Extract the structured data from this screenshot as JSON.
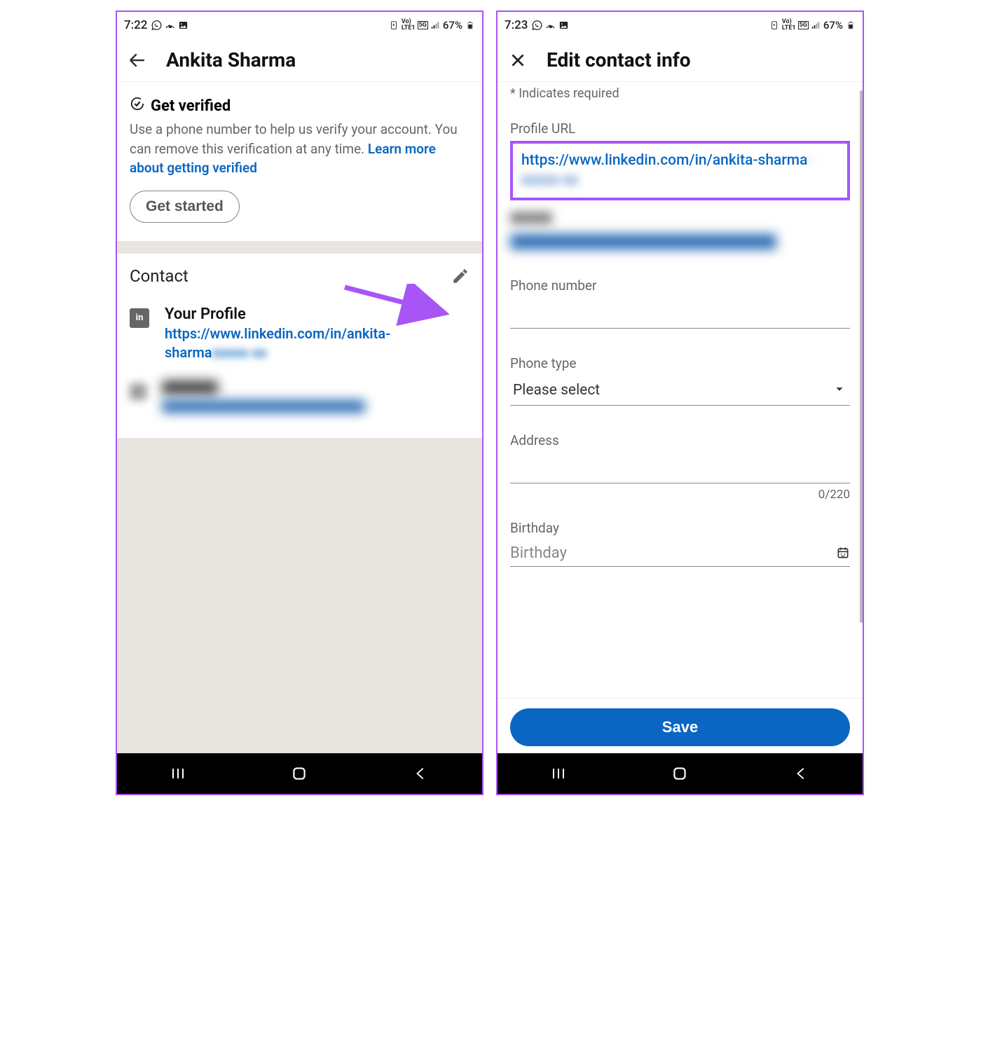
{
  "left": {
    "status": {
      "time": "7:22",
      "battery": "67%"
    },
    "header_title": "Ankita Sharma",
    "verified": {
      "title": "Get verified",
      "text": "Use a phone number to help us verify your account. You can remove this verification at any time. ",
      "link": "Learn more about getting verified",
      "button": "Get started"
    },
    "contact": {
      "section_title": "Contact",
      "profile_label": "Your Profile",
      "profile_url": "https://www.linkedin.com/in/ankita-sharma",
      "profile_url_hidden": "xxxxx-xx"
    }
  },
  "right": {
    "status": {
      "time": "7:23",
      "battery": "67%"
    },
    "header_title": "Edit contact info",
    "required_text": "* Indicates required",
    "profile_url_label": "Profile URL",
    "profile_url": "https://www.linkedin.com/in/ankita-sharma",
    "profile_url_hidden": "-xxxxx-xx",
    "phone_label": "Phone number",
    "phone_type_label": "Phone type",
    "phone_type_placeholder": "Please select",
    "address_label": "Address",
    "address_count": "0/220",
    "birthday_label": "Birthday",
    "birthday_placeholder": "Birthday",
    "save_button": "Save"
  }
}
